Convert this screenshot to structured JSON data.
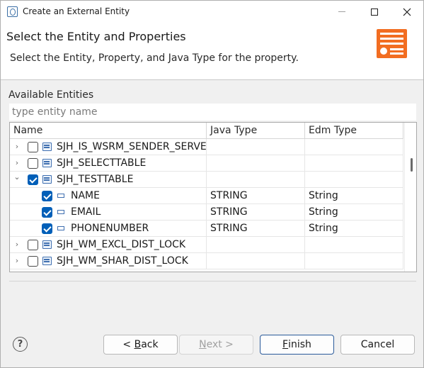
{
  "window": {
    "title": "Create an External Entity"
  },
  "header": {
    "title": "Select the Entity and Properties",
    "description": "Select the Entity, Property, and Java Type for the property."
  },
  "entities": {
    "label": "Available Entities",
    "filter_placeholder": "type entity name",
    "filter_value": "",
    "columns": [
      "Name",
      "Java Type",
      "Edm Type"
    ],
    "rows": [
      {
        "kind": "entity",
        "name": "SJH_IS_WSRM_SENDER_SERVER",
        "java_type": "",
        "edm_type": "",
        "expanded": false,
        "checked": false
      },
      {
        "kind": "entity",
        "name": "SJH_SELECTTABLE",
        "java_type": "",
        "edm_type": "",
        "expanded": false,
        "checked": false
      },
      {
        "kind": "entity",
        "name": "SJH_TESTTABLE",
        "java_type": "",
        "edm_type": "",
        "expanded": true,
        "checked": true
      },
      {
        "kind": "property",
        "name": "NAME",
        "java_type": "STRING",
        "edm_type": "String",
        "checked": true
      },
      {
        "kind": "property",
        "name": "EMAIL",
        "java_type": "STRING",
        "edm_type": "String",
        "checked": true
      },
      {
        "kind": "property",
        "name": "PHONENUMBER",
        "java_type": "STRING",
        "edm_type": "String",
        "checked": true
      },
      {
        "kind": "entity",
        "name": "SJH_WM_EXCL_DIST_LOCK",
        "java_type": "",
        "edm_type": "",
        "expanded": false,
        "checked": false
      },
      {
        "kind": "entity",
        "name": "SJH_WM_SHAR_DIST_LOCK",
        "java_type": "",
        "edm_type": "",
        "expanded": false,
        "checked": false
      }
    ]
  },
  "buttons": {
    "help": "?",
    "back_prefix": "< ",
    "back_mnemonic": "B",
    "back_rest": "ack",
    "next_mnemonic": "N",
    "next_rest": "ext >",
    "finish_mnemonic": "F",
    "finish_rest": "inish",
    "cancel": "Cancel"
  },
  "colors": {
    "accent": "#005fb8",
    "header_image": "#f26d21"
  }
}
